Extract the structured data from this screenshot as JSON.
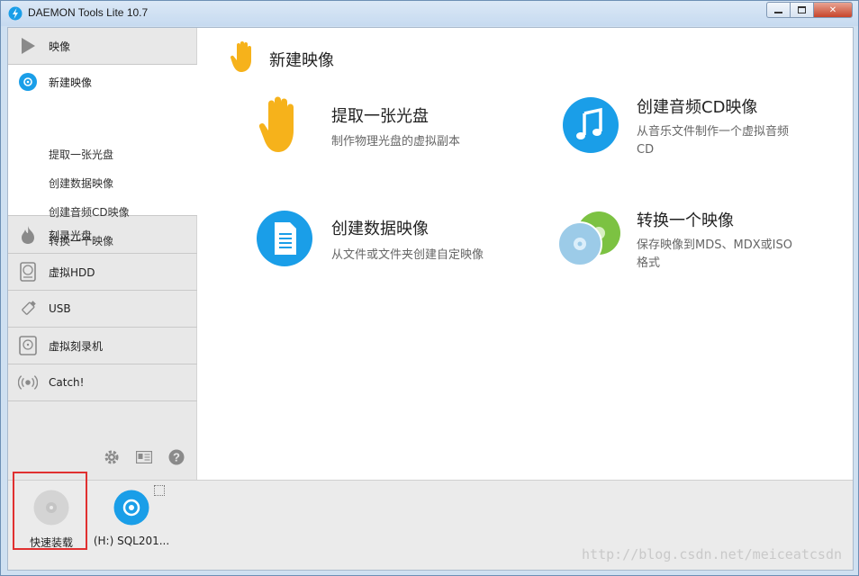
{
  "window": {
    "title": "DAEMON Tools Lite 10.7",
    "controls": {
      "minimize": "▭",
      "maximize": "▫",
      "close": "✕"
    }
  },
  "sidebar": {
    "items": [
      {
        "label": "映像",
        "icon": "play-icon"
      },
      {
        "label": "新建映像",
        "icon": "disc-icon",
        "expanded": true,
        "sub_items": [
          "提取一张光盘",
          "创建数据映像",
          "创建音频CD映像",
          "转换一个映像"
        ]
      },
      {
        "label": "刻录光盘",
        "icon": "flame-icon"
      },
      {
        "label": "虚拟HDD",
        "icon": "hdd-icon"
      },
      {
        "label": "USB",
        "icon": "usb-icon"
      },
      {
        "label": "虚拟刻录机",
        "icon": "burner-icon"
      },
      {
        "label": "Catch!",
        "icon": "catch-icon"
      }
    ],
    "tools": [
      "gear-icon",
      "id-card-icon",
      "help-icon"
    ]
  },
  "main": {
    "title": "新建映像",
    "cards": [
      {
        "title": "提取一张光盘",
        "desc": "制作物理光盘的虚拟副本",
        "icon": "hand-icon"
      },
      {
        "title": "创建音频CD映像",
        "desc_line1": "从音乐文件制作一个虚拟音频",
        "desc_line2": "CD",
        "icon": "music-icon"
      },
      {
        "title": "创建数据映像",
        "desc": "从文件或文件夹创建自定映像",
        "icon": "document-icon"
      },
      {
        "title": "转换一个映像",
        "desc_line1": "保存映像到MDS、MDX或ISO",
        "desc_line2": "格式",
        "icon": "convert-discs-icon"
      }
    ]
  },
  "bottom": {
    "drives": [
      {
        "label": "快速装载",
        "icon": "quick-mount-disc-icon"
      },
      {
        "label": "(H:) SQL201...",
        "icon": "mounted-disc-icon"
      }
    ],
    "watermark": "http://blog.csdn.net/meiceatcsdn"
  },
  "colors": {
    "accent_blue": "#1a9ee8",
    "hand_yellow": "#f6b21b",
    "green": "#7cc242",
    "highlight_red": "#e03030"
  }
}
